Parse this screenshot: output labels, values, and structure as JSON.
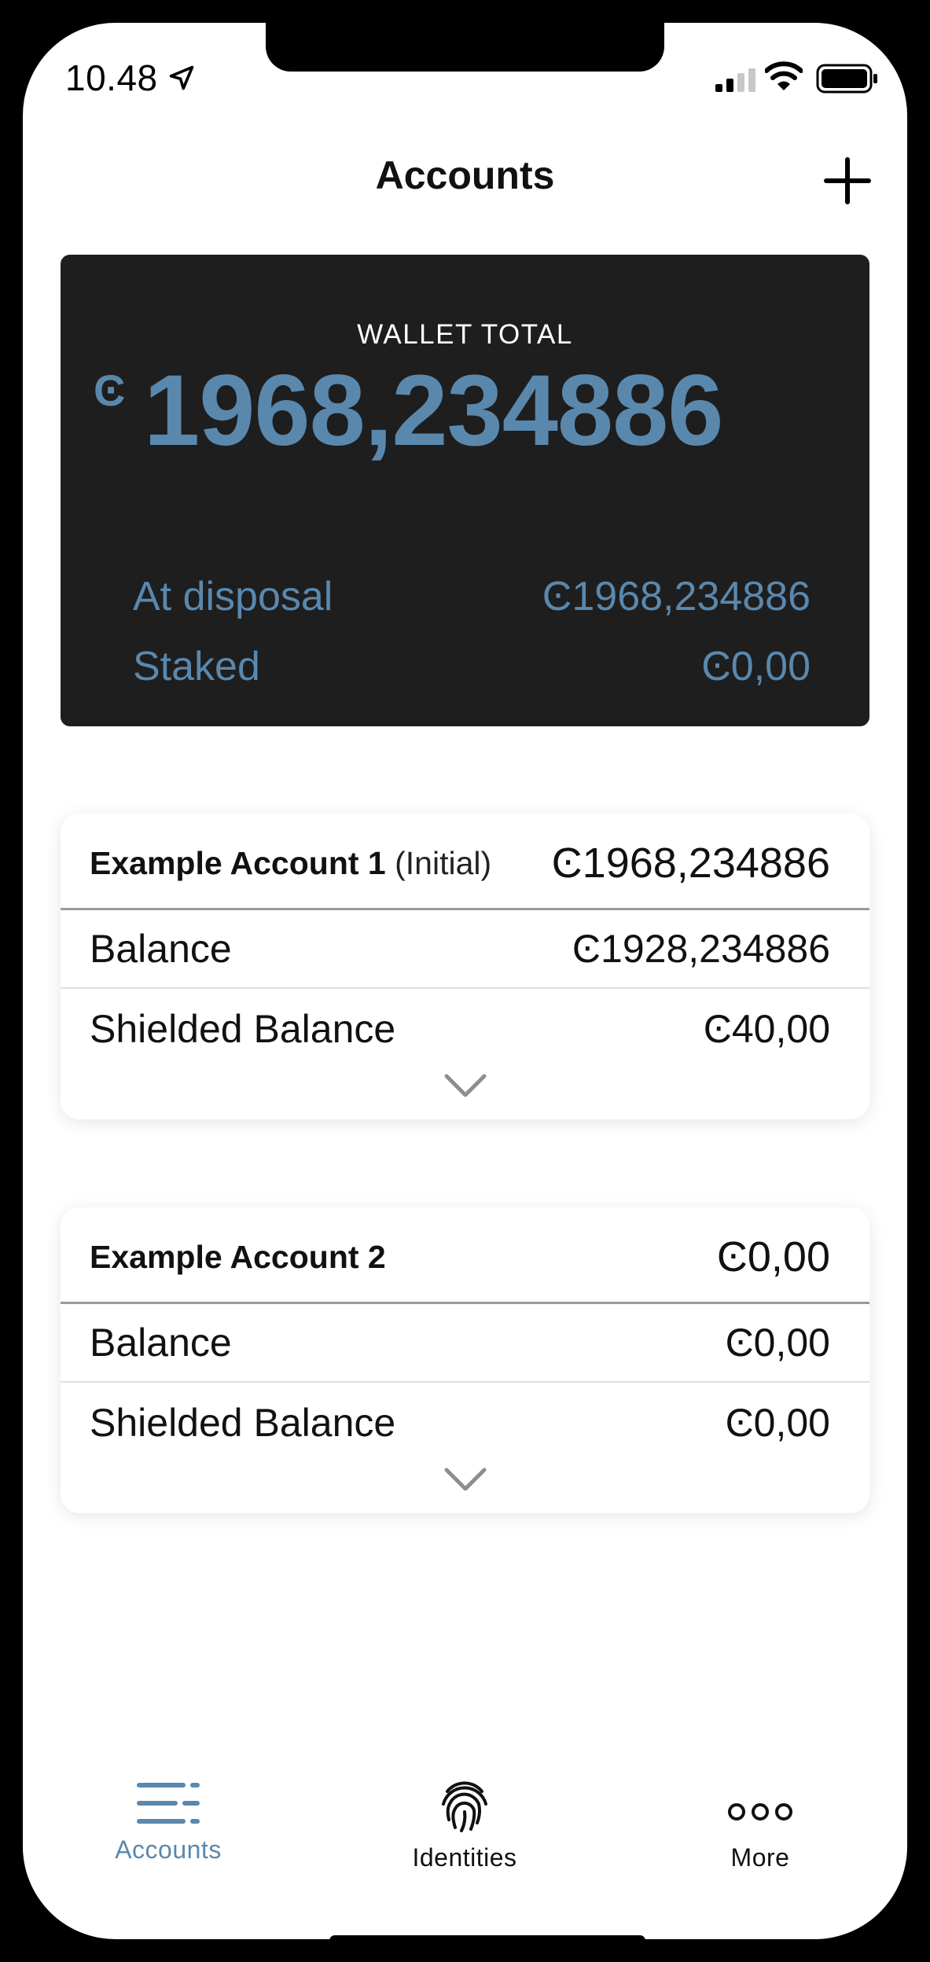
{
  "status_bar": {
    "time": "10.48"
  },
  "header": {
    "title": "Accounts"
  },
  "wallet": {
    "label": "WALLET TOTAL",
    "currency_symbol": "Ͼ",
    "total": "1968,234886",
    "rows": [
      {
        "label": "At disposal",
        "value": "Ͼ1968,234886"
      },
      {
        "label": "Staked",
        "value": "Ͼ0,00"
      }
    ]
  },
  "accounts": [
    {
      "name": "Example Account 1",
      "tag": " (Initial)",
      "total": "Ͼ1968,234886",
      "balance_label": "Balance",
      "balance": "Ͼ1928,234886",
      "shielded_label": "Shielded Balance",
      "shielded": "Ͼ40,00"
    },
    {
      "name": "Example Account 2",
      "tag": "",
      "total": "Ͼ0,00",
      "balance_label": "Balance",
      "balance": "Ͼ0,00",
      "shielded_label": "Shielded Balance",
      "shielded": "Ͼ0,00"
    }
  ],
  "tabs": [
    {
      "label": "Accounts",
      "icon": "accounts-list-icon",
      "active": true
    },
    {
      "label": "Identities",
      "icon": "fingerprint-icon",
      "active": false
    },
    {
      "label": "More",
      "icon": "more-dots-icon",
      "active": false
    }
  ],
  "colors": {
    "accent": "#5a88ad",
    "card_dark": "#1e1e1f",
    "text": "#111111"
  }
}
